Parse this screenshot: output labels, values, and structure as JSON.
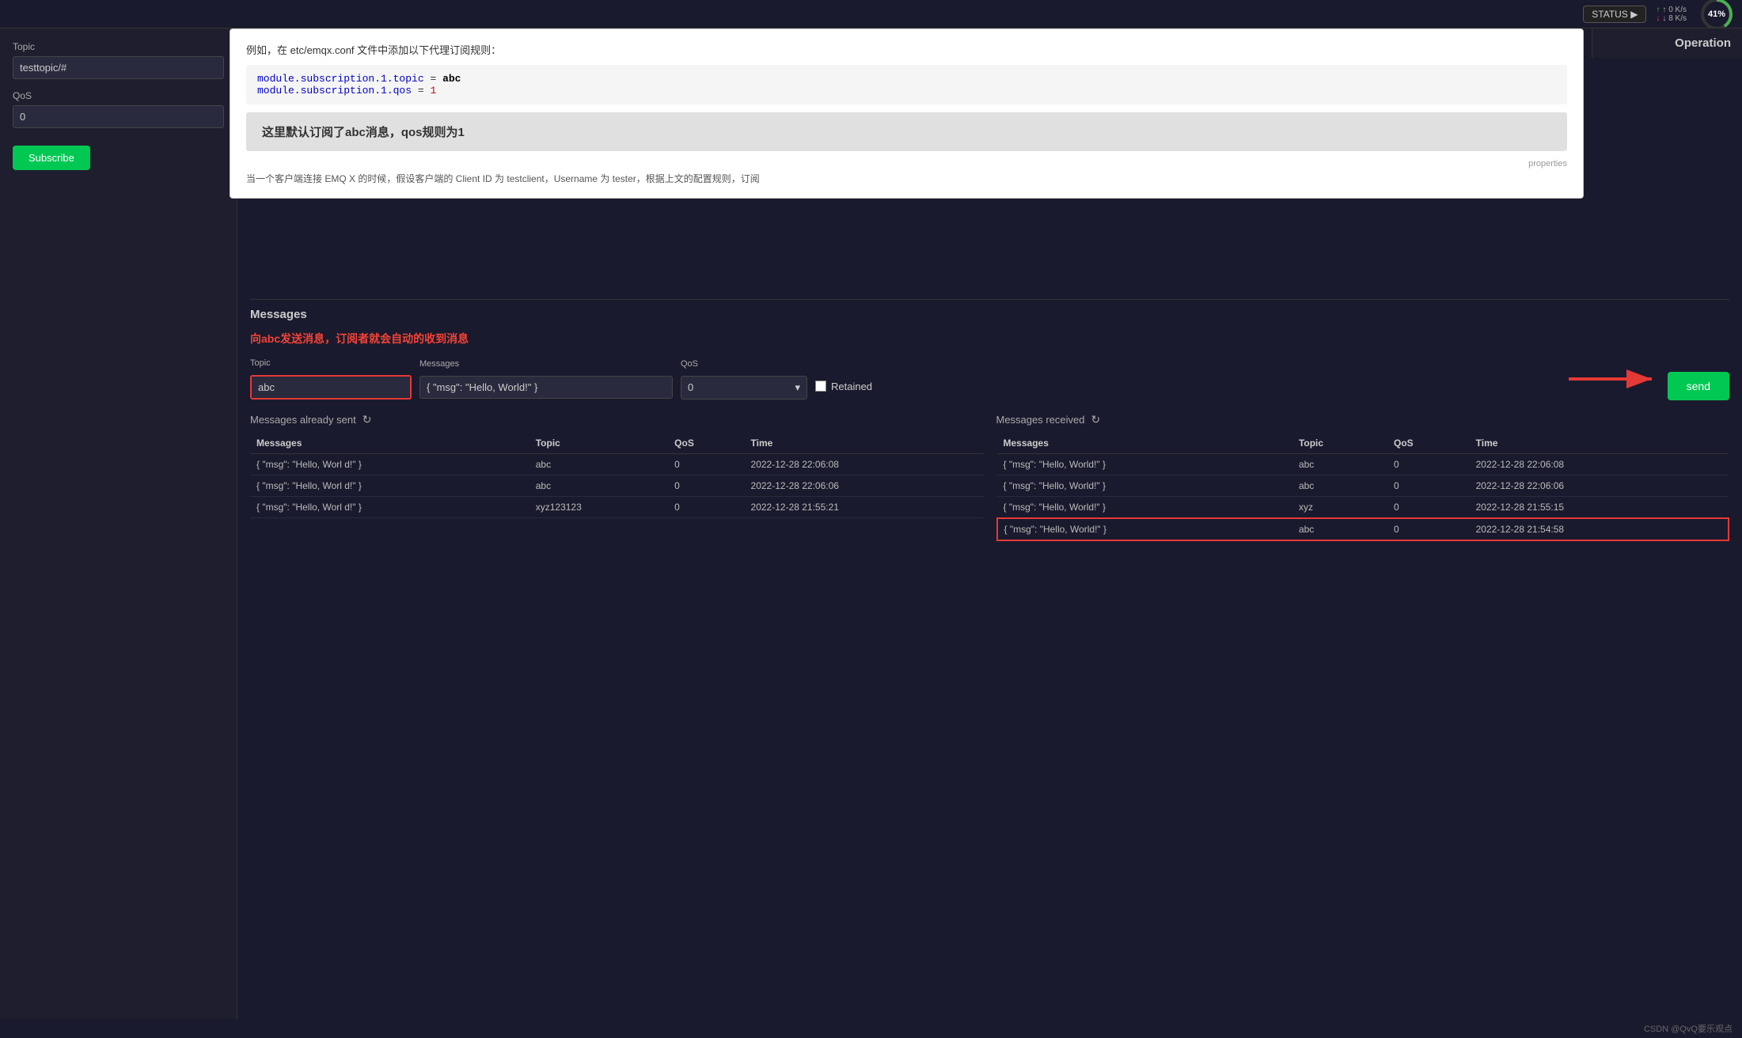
{
  "topbar": {
    "status_btn": "STATUS ▶",
    "speed_up": "↑ 0 K/s",
    "speed_down": "↓ 8 K/s",
    "cpu_percent": "41%",
    "operation_label": "Operation"
  },
  "left_panel": {
    "topic_label": "Topic",
    "topic_value": "testtopic/#",
    "qos_label": "QoS",
    "qos_value": "0",
    "subscribe_btn": "Subscribe"
  },
  "popup": {
    "intro": "例如，在 etc/emqx.conf 文件中添加以下代理订阅规则：",
    "code_line1_key": "module.subscription.1.topic",
    "code_line1_val": " abc",
    "code_line2_key": "module.subscription.1.qos",
    "code_line2_val": " 1",
    "highlight_text": "这里默认订阅了abc消息，qos规则为1",
    "properties_label": "properties",
    "footer_text": "当一个客户端连接 EMQ X 的时候，假设客户端的 Client ID 为 testclient，Username 为 tester，根据上文的配置规则，订阅"
  },
  "messages_section": {
    "title": "Messages",
    "announce": "向abc发送消息，订阅者就会自动的收到消息",
    "topic_label": "Topic",
    "topic_value": "abc",
    "messages_label": "Messages",
    "messages_value": "{ \"msg\": \"Hello, World!\" }",
    "qos_label": "QoS",
    "qos_value": "0",
    "retained_label": "Retained",
    "send_btn": "send"
  },
  "sent_table": {
    "header": "Messages already sent",
    "columns": [
      "Messages",
      "Topic",
      "QoS",
      "Time"
    ],
    "rows": [
      {
        "msg": "{ \"msg\": \"Hello, Worl d!\" }",
        "topic": "abc",
        "qos": "0",
        "time": "2022-12-28 22:06:08"
      },
      {
        "msg": "{ \"msg\": \"Hello, Worl d!\" }",
        "topic": "abc",
        "qos": "0",
        "time": "2022-12-28 22:06:06"
      },
      {
        "msg": "{ \"msg\": \"Hello, Worl d!\" }",
        "topic": "xyz123123",
        "qos": "0",
        "time": "2022-12-28 21:55:21"
      }
    ]
  },
  "received_table": {
    "header": "Messages received",
    "columns": [
      "Messages",
      "Topic",
      "QoS",
      "Time"
    ],
    "rows": [
      {
        "msg": "{ \"msg\": \"Hello, World!\" }",
        "topic": "abc",
        "qos": "0",
        "time": "2022-12-28 22:06:08",
        "highlight": false
      },
      {
        "msg": "{ \"msg\": \"Hello, World!\" }",
        "topic": "abc",
        "qos": "0",
        "time": "2022-12-28 22:06:06",
        "highlight": false
      },
      {
        "msg": "{ \"msg\": \"Hello, World!\" }",
        "topic": "xyz",
        "qos": "0",
        "time": "2022-12-28 21:55:15",
        "highlight": false
      },
      {
        "msg": "{ \"msg\": \"Hello, World!\" }",
        "topic": "abc",
        "qos": "0",
        "time": "2022-12-28 21:54:58",
        "highlight": true
      }
    ]
  },
  "attribution": "CSDN @QvQ要乐观点"
}
